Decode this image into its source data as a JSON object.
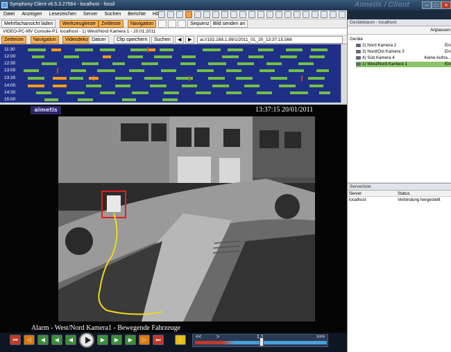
{
  "window": {
    "title": "Symphony Client v6.5.3.27564 - localhost - fossil",
    "brand": "Aimetis / Client"
  },
  "menu": [
    "Datei",
    "Anzeigen",
    "Lesezeichen",
    "Server",
    "Suchen",
    "Berichte",
    "Hilfe"
  ],
  "toolbar1": {
    "multiview": "Mehrfachansicht laden",
    "toolbar_label": "Werkzeugleiste",
    "timeline_label": "Zeitleiste",
    "navigation_label": "Navigation",
    "sequence": "Sequenz",
    "send_image": "Bild senden an"
  },
  "video_title": "VIDEO-PC-MV Console-P1: localhost - 1) West/Nord Kamera 1 - 20.01.2011",
  "toolbar2": {
    "timeline": "Zeitleiste",
    "navigation": "Navigation",
    "videodeko": "Videodeko",
    "date": "Datum",
    "clip_save": "Clip speichern",
    "search": "Suchen",
    "url": "ai://192.168.1.99/1/2011_01_20_13:37:15.566"
  },
  "timeline": {
    "rows": [
      {
        "time": "11:30"
      },
      {
        "time": "12:00"
      },
      {
        "time": "12:30"
      },
      {
        "time": "13:00"
      },
      {
        "time": "13:30"
      },
      {
        "time": "14:00"
      },
      {
        "time": "14:30"
      },
      {
        "time": "15:00"
      }
    ]
  },
  "viewer": {
    "logo": "aimetis",
    "timestamp": "13:37:15 20/01/2011",
    "caption": "Alarm - West/Nord Kamera1 - Bewegende Fahrzeuge"
  },
  "playback": {
    "speed_marks": [
      "<<",
      ">",
      "1.1",
      ">>>"
    ]
  },
  "device_tree": {
    "title": "Gerätebaum - localhost",
    "adjust": "Anpassen",
    "root": "Geräte",
    "columns_status": "",
    "items": [
      {
        "label": "2) Nord Kamera 2",
        "status": "Ein",
        "selected": false
      },
      {
        "label": "3) Nord/Ost Kamera 3",
        "status": "Ein",
        "selected": false
      },
      {
        "label": "4) Süd Kamera 4",
        "status": "Keine Aufna...",
        "selected": false
      },
      {
        "label": "1) West/Nord Kamera 1",
        "status": "Ein",
        "selected": true
      }
    ]
  },
  "server_list": {
    "title": "Serverliste",
    "headers": [
      "Server",
      "Status"
    ],
    "rows": [
      {
        "server": "localhost",
        "status": "Verbindung hergestellt"
      }
    ]
  }
}
